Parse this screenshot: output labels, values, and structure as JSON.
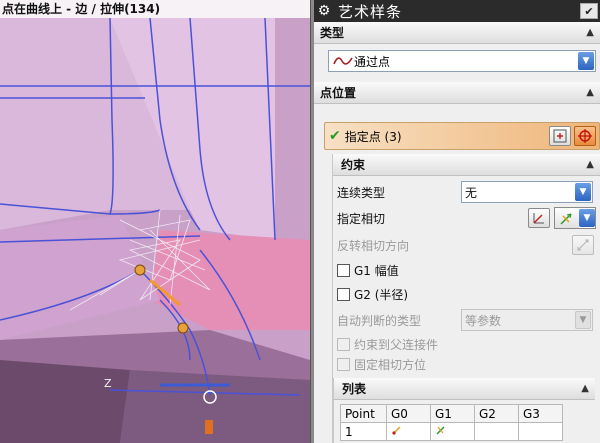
{
  "viewport": {
    "status_text": "点在曲线上 - 边 / 拉伸(134)",
    "axis_label": "Z"
  },
  "dialog": {
    "title": "艺术样条",
    "sections": {
      "type": {
        "header": "类型",
        "selected": "通过点"
      },
      "point_position": {
        "header": "点位置",
        "specify_label": "指定点 (3)"
      },
      "constraints": {
        "header": "约束",
        "continuity_label": "连续类型",
        "continuity_value": "无",
        "tangent_label": "指定相切",
        "reverse_label": "反转相切方向",
        "g1_label": "G1 幅值",
        "g2_label": "G2 (半径)",
        "auto_type_label": "自动判断的类型",
        "auto_type_value": "等参数",
        "constrain_parent_label": "约束到父连接件",
        "fix_tangent_label": "固定相切方位"
      },
      "list": {
        "header": "列表",
        "columns": [
          "Point",
          "G0",
          "G1",
          "G2",
          "G3"
        ],
        "rows": [
          [
            "1",
            "",
            "",
            "",
            ""
          ]
        ]
      }
    }
  },
  "colors": {
    "accent_orange": "#efb578",
    "combo_arrow_blue": "#2c64c0",
    "viewport_pink": "#c39ac2",
    "curve_blue": "#4a52d8"
  }
}
